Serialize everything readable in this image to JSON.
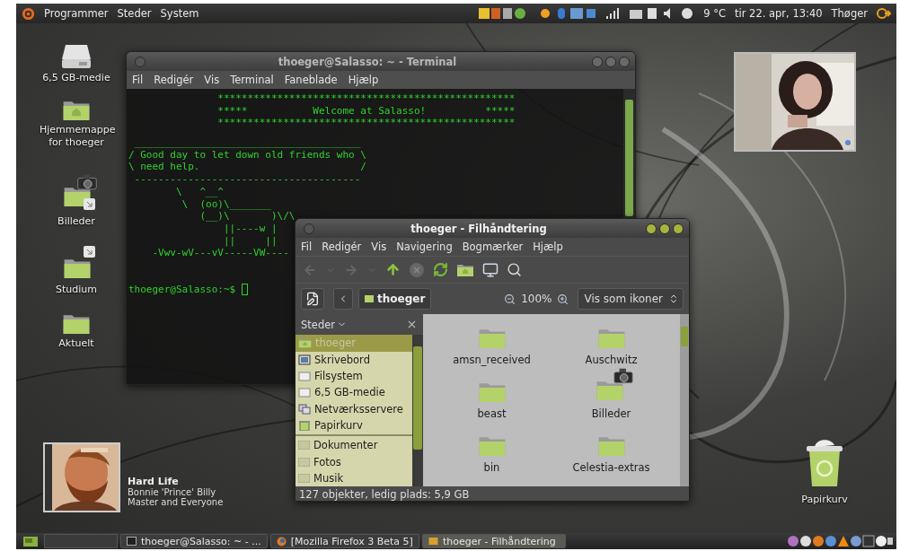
{
  "top_panel": {
    "menus": [
      "Programmer",
      "Steder",
      "System"
    ],
    "weather": "9 °C",
    "clock": "tir 22. apr, 13:40",
    "user": "Thøger"
  },
  "desktop_icons": [
    {
      "label": "6,5 GB-medie",
      "kind": "drive"
    },
    {
      "label": "Hjemmemappe for thoeger",
      "kind": "home"
    },
    {
      "label": "Billeder",
      "kind": "pictures-link"
    },
    {
      "label": "Studium",
      "kind": "folder-link"
    },
    {
      "label": "Aktuelt",
      "kind": "folder"
    }
  ],
  "terminal": {
    "title": "thoeger@Salasso: ~ - Terminal",
    "menu": [
      "Fil",
      "Redigér",
      "Vis",
      "Terminal",
      "Faneblade",
      "Hjælp"
    ],
    "banner": [
      "               **************************************************",
      "               *****           Welcome at Salasso!          *****",
      "               **************************************************"
    ],
    "cowsay": [
      " ______________________________________",
      "/ Good day to let down old friends who \\",
      "\\ need help.                           /",
      " --------------------------------------",
      "        \\   ^__^",
      "         \\  (oo)\\_______",
      "            (__)\\       )\\/\\",
      "                ||----w |",
      "                ||     ||",
      "    -Vwv-wV---vV-----VW----"
    ],
    "prompt": "thoeger@Salasso:~$ "
  },
  "file_manager": {
    "title": "thoeger - Filhåndtering",
    "menu": [
      "Fil",
      "Redigér",
      "Vis",
      "Navigering",
      "Bogmærker",
      "Hjælp"
    ],
    "location": "thoeger",
    "zoom": "100%",
    "view": "Vis som ikoner",
    "sidebar_title": "Steder",
    "places": [
      {
        "label": "thoeger",
        "kind": "home",
        "selected": true
      },
      {
        "label": "Skrivebord",
        "kind": "desktop",
        "selected": false
      },
      {
        "label": "Filsystem",
        "kind": "drive",
        "selected": false
      },
      {
        "label": "6,5 GB-medie",
        "kind": "drive",
        "selected": false
      },
      {
        "label": "Netværksservere",
        "kind": "network",
        "selected": false
      },
      {
        "label": "Papirkurv",
        "kind": "trash",
        "selected": false
      }
    ],
    "bookmarks": [
      {
        "label": "Dokumenter",
        "selected": false
      },
      {
        "label": "Fotos",
        "selected": false
      },
      {
        "label": "Musik",
        "selected": false
      }
    ],
    "files": [
      {
        "name": "amsn_received",
        "kind": "folder"
      },
      {
        "name": "Auschwitz",
        "kind": "folder"
      },
      {
        "name": "beast",
        "kind": "folder"
      },
      {
        "name": "Billeder",
        "kind": "pictures"
      },
      {
        "name": "bin",
        "kind": "folder"
      },
      {
        "name": "Celestia-extras",
        "kind": "folder"
      }
    ],
    "status": "127 objekter, ledig plads: 5,9 GB"
  },
  "music": {
    "title": "Hard Life",
    "artist": "Bonnie 'Prince' Billy",
    "album": "Master and Everyone"
  },
  "trash": {
    "label": "Papirkurv"
  },
  "taskbar": [
    {
      "label": "thoeger@Salasso: ~ - ...",
      "kind": "terminal",
      "selected": false
    },
    {
      "label": "[Mozilla Firefox 3 Beta 5]",
      "kind": "browser",
      "selected": false
    },
    {
      "label": "thoeger - Filhåndtering",
      "kind": "files",
      "selected": true
    }
  ]
}
